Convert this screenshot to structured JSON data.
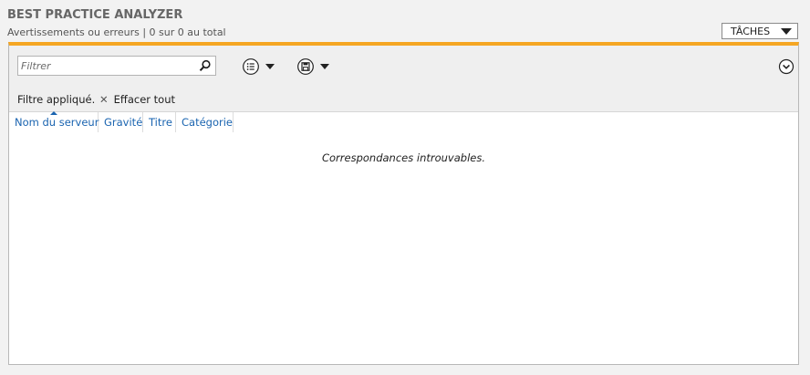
{
  "header": {
    "title": "BEST PRACTICE ANALYZER",
    "subtitle": "Avertissements ou erreurs | 0 sur 0 au total",
    "tasks_label": "TÂCHES"
  },
  "toolbar": {
    "filter_placeholder": "Filtrer",
    "filter_value": "",
    "icons": [
      "search-icon",
      "list-options-icon",
      "save-icon",
      "expand-icon"
    ]
  },
  "filter_bar": {
    "status": "Filtre appliqué.",
    "clear_all": "Effacer tout"
  },
  "table": {
    "columns": [
      "Nom du serveur",
      "Gravité",
      "Titre",
      "Catégorie"
    ],
    "empty_message": "Correspondances introuvables."
  },
  "colors": {
    "accent_bar": "#f5a623",
    "column_link": "#1a64b0"
  }
}
